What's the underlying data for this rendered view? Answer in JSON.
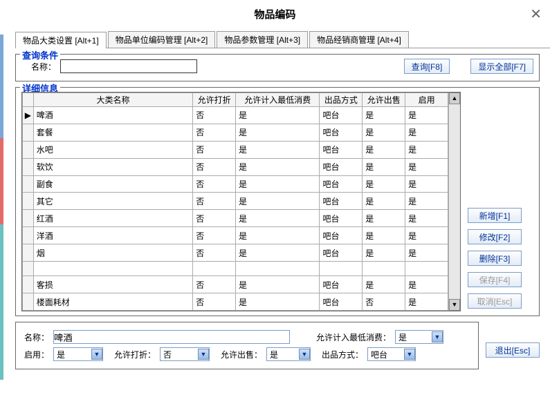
{
  "title": "物品编码",
  "tabs": [
    "物品大类设置 [Alt+1]",
    "物品单位编码管理 [Alt+2]",
    "物品参数管理 [Alt+3]",
    "物品经销商管理 [Alt+4]"
  ],
  "query": {
    "legend": "查询条件",
    "name_label": "名称：",
    "name_value": "",
    "search_btn": "查询[F8]",
    "showall_btn": "显示全部[F7]"
  },
  "details": {
    "legend": "详细信息",
    "columns": [
      "大类名称",
      "允许打折",
      "允许计入最低消费",
      "出品方式",
      "允许出售",
      "启用"
    ],
    "rows": [
      {
        "name": "啤酒",
        "discount": "否",
        "minconsume": "是",
        "output": "吧台",
        "sell": "是",
        "enable": "是",
        "current": true
      },
      {
        "name": "套餐",
        "discount": "否",
        "是": "是",
        "minconsume": "是",
        "output": "吧台",
        "sell": "是",
        "enable": "是"
      },
      {
        "name": "水吧",
        "discount": "否",
        "minconsume": "是",
        "output": "吧台",
        "sell": "是",
        "enable": "是"
      },
      {
        "name": "软饮",
        "discount": "否",
        "minconsume": "是",
        "output": "吧台",
        "sell": "是",
        "enable": "是"
      },
      {
        "name": "副食",
        "discount": "否",
        "minconsume": "是",
        "output": "吧台",
        "sell": "是",
        "enable": "是"
      },
      {
        "name": "其它",
        "discount": "否",
        "minconsume": "是",
        "output": "吧台",
        "sell": "是",
        "enable": "是"
      },
      {
        "name": "红酒",
        "discount": "否",
        "minconsume": "是",
        "output": "吧台",
        "sell": "是",
        "enable": "是"
      },
      {
        "name": "洋酒",
        "discount": "否",
        "minconsume": "是",
        "output": "吧台",
        "sell": "是",
        "enable": "是"
      },
      {
        "name": "烟",
        "discount": "否",
        "minconsume": "是",
        "output": "吧台",
        "sell": "是",
        "enable": "是"
      },
      {
        "name": "",
        "discount": "",
        "minconsume": "",
        "output": "",
        "sell": "",
        "enable": ""
      },
      {
        "name": "客损",
        "discount": "否",
        "minconsume": "是",
        "output": "吧台",
        "sell": "是",
        "enable": "是"
      },
      {
        "name": "楼面耗材",
        "discount": "否",
        "minconsume": "是",
        "output": "吧台",
        "sell": "否",
        "enable": "是"
      }
    ]
  },
  "sidebuttons": {
    "add": "新增[F1]",
    "edit": "修改[F2]",
    "del": "删除[F3]",
    "save": "保存[F4]",
    "cancel": "取消[Esc]"
  },
  "form": {
    "name_label": "名称：",
    "name_value": "啤酒",
    "minconsume_label": "允许计入最低消费：",
    "minconsume_value": "是",
    "enable_label": "启用：",
    "enable_value": "是",
    "discount_label": "允许打折：",
    "discount_value": "否",
    "sell_label": "允许出售：",
    "sell_value": "是",
    "output_label": "出品方式：",
    "output_value": "吧台"
  },
  "exit_btn": "退出[Esc]"
}
